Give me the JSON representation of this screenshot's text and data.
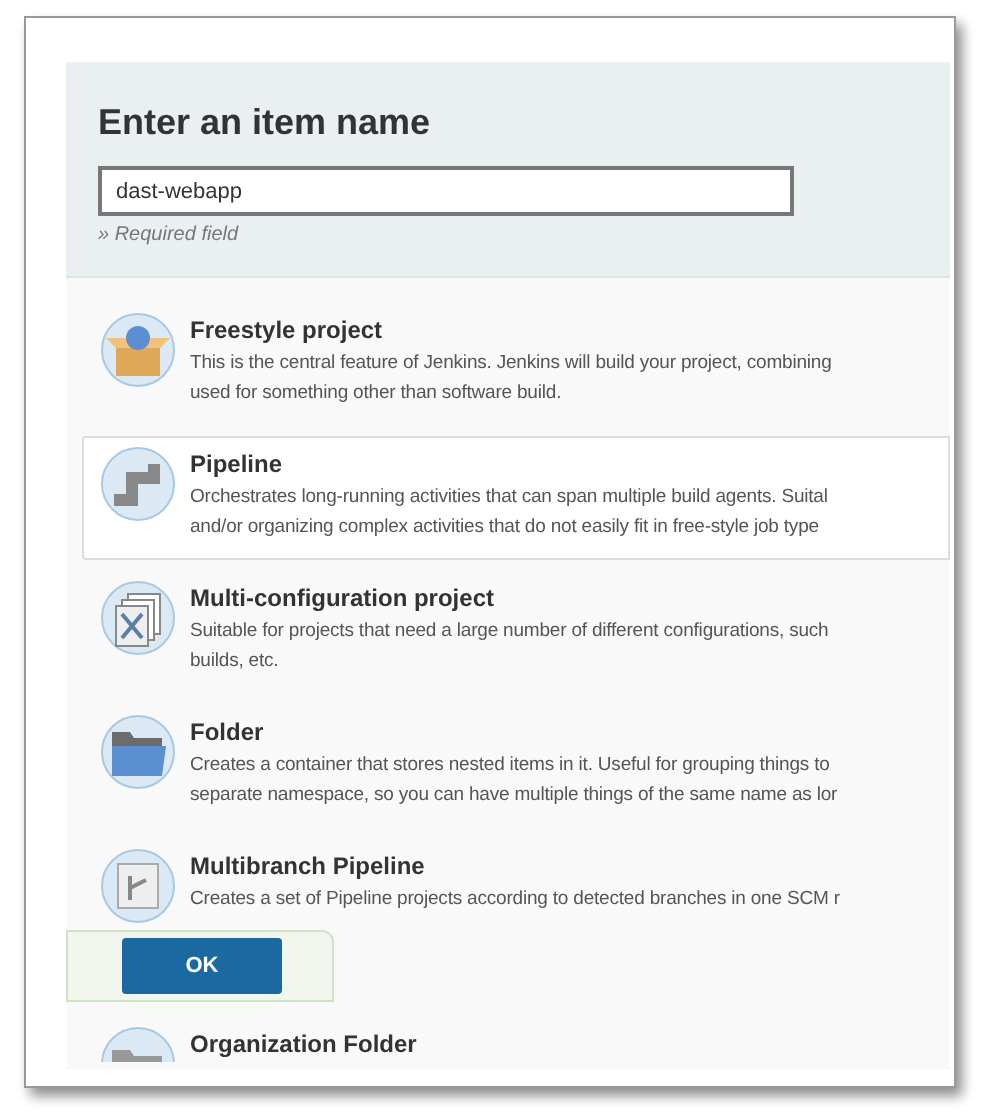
{
  "heading": "Enter an item name",
  "name_field": {
    "value": "dast-webapp",
    "hint": "» Required field"
  },
  "items": [
    {
      "kind": "freestyle",
      "title": "Freestyle project",
      "selected": false,
      "lines": [
        "This is the central feature of Jenkins. Jenkins will build your project, combining",
        "used for something other than software build."
      ]
    },
    {
      "kind": "pipeline",
      "title": "Pipeline",
      "selected": true,
      "lines": [
        "Orchestrates long-running activities that can span multiple build agents. Suital",
        "and/or organizing complex activities that do not easily fit in free-style job type"
      ]
    },
    {
      "kind": "multiconfig",
      "title": "Multi-configuration project",
      "selected": false,
      "lines": [
        "Suitable for projects that need a large number of different configurations, such",
        "builds, etc."
      ]
    },
    {
      "kind": "folder",
      "title": "Folder",
      "selected": false,
      "lines": [
        "Creates a container that stores nested items in it. Useful for grouping things to",
        "separate namespace, so you can have multiple things of the same name as lor"
      ]
    },
    {
      "kind": "multibranch",
      "title": "Multibranch Pipeline",
      "selected": false,
      "lines": [
        "Creates a set of Pipeline projects according to detected branches in one SCM r"
      ]
    },
    {
      "kind": "orgfolder",
      "title": "Organization Folder",
      "selected": false
    }
  ],
  "ok_button": "OK"
}
